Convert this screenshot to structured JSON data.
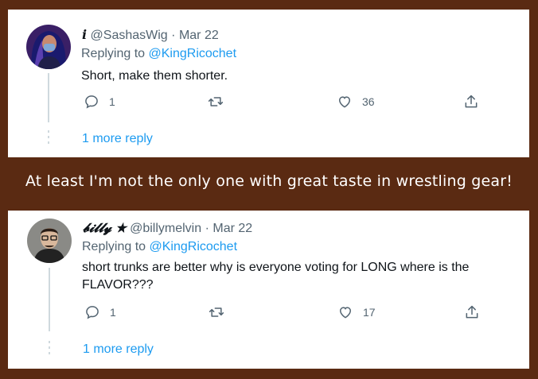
{
  "caption": "At least I'm not the only one with great taste in wrestling gear!",
  "tweets": [
    {
      "display_name": "i",
      "handle": "@SashasWig",
      "separator": "·",
      "date": "Mar 22",
      "replying_prefix": "Replying to",
      "replying_to": "@KingRicochet",
      "text": "Short, make them shorter.",
      "reply_count": "1",
      "retweet_count": "",
      "like_count": "36",
      "more_replies": "1 more reply"
    },
    {
      "display_name": "𝓫𝓲𝓵𝓵𝔂 ★",
      "handle": "@billymelvin",
      "separator": "·",
      "date": "Mar 22",
      "replying_prefix": "Replying to",
      "replying_to": "@KingRicochet",
      "text": "short trunks are better why is everyone voting for LONG where is the FLAVOR???",
      "reply_count": "1",
      "retweet_count": "",
      "like_count": "17",
      "more_replies": "1 more reply"
    }
  ],
  "icons": {
    "reply": "reply-icon",
    "retweet": "retweet-icon",
    "like": "heart-icon",
    "share": "share-icon"
  },
  "colors": {
    "background": "#5a2a12",
    "link": "#1d9bf0",
    "muted": "#536471"
  }
}
